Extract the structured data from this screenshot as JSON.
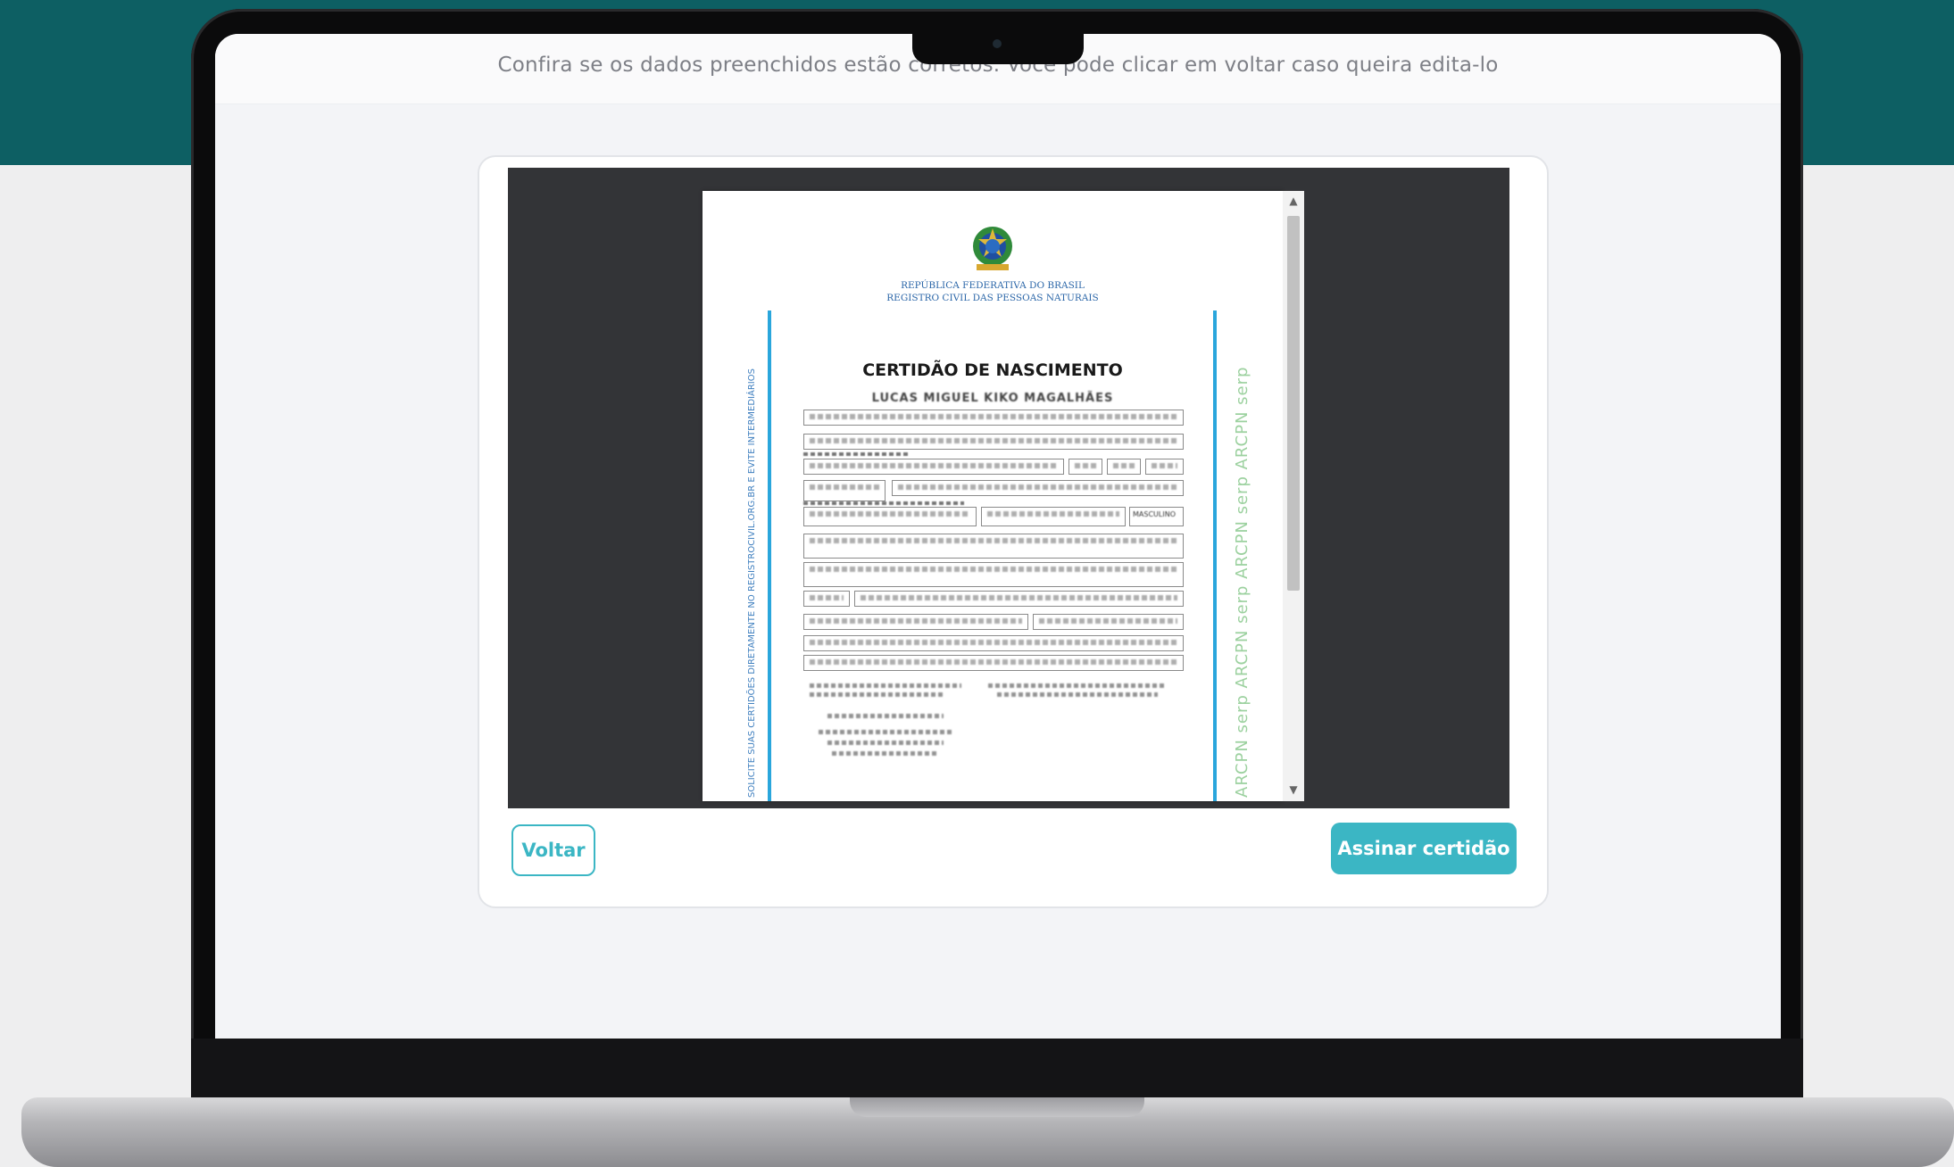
{
  "page": {
    "instructions": "Confira se os dados preenchidos estão corretos. Você pode clicar em voltar caso queira edita-lo"
  },
  "document": {
    "republic_line1": "REPÚBLICA FEDERATIVA DO BRASIL",
    "republic_line2": "REGISTRO CIVIL DAS PESSOAS NATURAIS",
    "title": "CERTIDÃO DE NASCIMENTO",
    "name": "LUCAS MIGUEL KIKO MAGALHÃES",
    "side_text": "SOLICITE SUAS CERTIDÕES DIRETAMENTE NO REGISTROCIVIL.ORG.BR E EVITE INTERMEDIÁRIOS",
    "serp_strip": "ARCPN serp ARCPN serp ARCPN serp ARCPN serp",
    "sex_value": "MASCULINO"
  },
  "actions": {
    "back_label": "Voltar",
    "sign_label": "Assinar certidão"
  },
  "colors": {
    "accent": "#3bb6c4",
    "header_band": "#0d5f63",
    "viewer_bg": "#333437"
  }
}
